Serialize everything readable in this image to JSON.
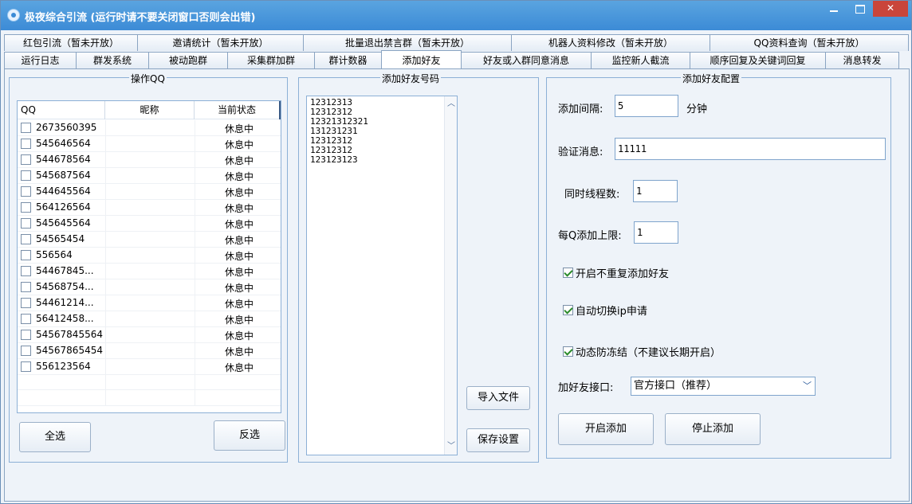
{
  "window": {
    "title": "极夜综合引流 (运行时请不要关闭窗口否则会出错)"
  },
  "tabs_row1": [
    {
      "label": "红包引流（暂未开放）"
    },
    {
      "label": "邀请统计（暂未开放）"
    },
    {
      "label": "批量退出禁言群（暂未开放）"
    },
    {
      "label": "机器人资料修改（暂未开放）"
    },
    {
      "label": "QQ资料查询（暂未开放）"
    }
  ],
  "tabs_row2": [
    {
      "label": "运行日志"
    },
    {
      "label": "群发系统"
    },
    {
      "label": "被动跑群"
    },
    {
      "label": "采集群加群"
    },
    {
      "label": "群计数器"
    },
    {
      "label": "添加好友",
      "active": true
    },
    {
      "label": "好友或入群同意消息"
    },
    {
      "label": "监控新人截流"
    },
    {
      "label": "顺序回复及关键词回复"
    },
    {
      "label": "消息转发"
    }
  ],
  "qq_group": {
    "title": "操作QQ",
    "columns": [
      "QQ",
      "昵称",
      "当前状态"
    ],
    "rows": [
      {
        "qq": "2673560395",
        "nick": "",
        "status": "休息中"
      },
      {
        "qq": "545646564",
        "nick": "",
        "status": "休息中"
      },
      {
        "qq": "544678564",
        "nick": "",
        "status": "休息中"
      },
      {
        "qq": "545687564",
        "nick": "",
        "status": "休息中"
      },
      {
        "qq": "544645564",
        "nick": "",
        "status": "休息中"
      },
      {
        "qq": "564126564",
        "nick": "",
        "status": "休息中"
      },
      {
        "qq": "545645564",
        "nick": "",
        "status": "休息中"
      },
      {
        "qq": "54565454",
        "nick": "",
        "status": "休息中"
      },
      {
        "qq": "556564",
        "nick": "",
        "status": "休息中"
      },
      {
        "qq": "54467845...",
        "nick": "",
        "status": "休息中"
      },
      {
        "qq": "54568754...",
        "nick": "",
        "status": "休息中"
      },
      {
        "qq": "54461214...",
        "nick": "",
        "status": "休息中"
      },
      {
        "qq": "56412458...",
        "nick": "",
        "status": "休息中"
      },
      {
        "qq": "54567845564",
        "nick": "",
        "status": "休息中"
      },
      {
        "qq": "54567865454",
        "nick": "",
        "status": "休息中"
      },
      {
        "qq": "556123564",
        "nick": "",
        "status": "休息中"
      }
    ],
    "select_all": "全选",
    "invert_select": "反选"
  },
  "numbers_group": {
    "title": "添加好友号码",
    "lines": [
      "12312313",
      "12312312",
      "12321312321",
      "131231231",
      "12312312",
      "12312312",
      "123123123"
    ],
    "import_file": "导入文件",
    "save_settings": "保存设置"
  },
  "config_group": {
    "title": "添加好友配置",
    "interval_label": "添加间隔:",
    "interval_value": "5",
    "interval_unit": "分钟",
    "verify_label": "验证消息:",
    "verify_value": "11111",
    "threads_label": "同时线程数:",
    "threads_value": "1",
    "limit_label": "每Q添加上限:",
    "limit_value": "1",
    "opt_no_repeat": "开启不重复添加好友",
    "opt_switch_ip": "自动切换ip申请",
    "opt_anti_freeze": "动态防冻结（不建议长期开启）",
    "api_label": "加好友接口:",
    "api_value": "官方接口（推荐）",
    "start_button": "开启添加",
    "stop_button": "停止添加"
  }
}
